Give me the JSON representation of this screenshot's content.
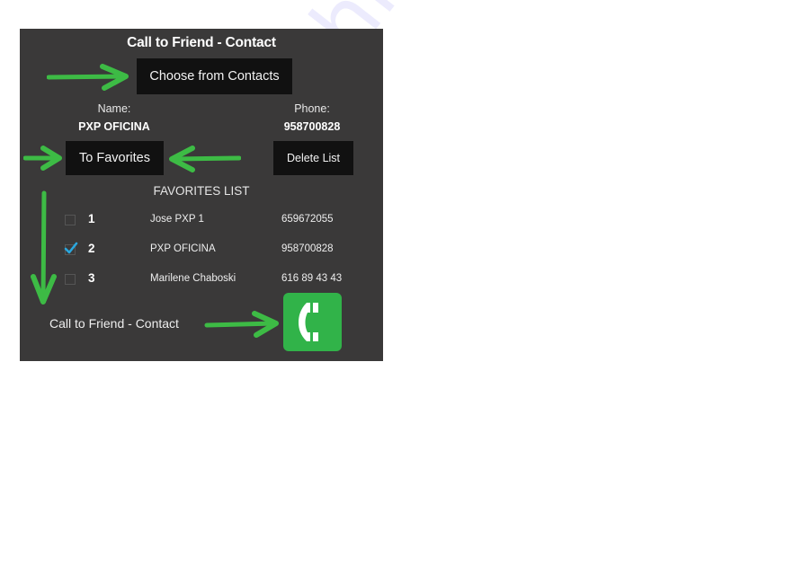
{
  "app": {
    "title": "Call to Friend - Contact"
  },
  "buttons": {
    "choose_contacts": "Choose from Contacts",
    "to_favorites": "To Favorites",
    "delete_list": "Delete List"
  },
  "selected_contact": {
    "name_label": "Name:",
    "name_value": "PXP OFICINA",
    "phone_label": "Phone:",
    "phone_value": "958700828"
  },
  "favorites": {
    "heading": "FAVORITES LIST",
    "rows": [
      {
        "index": "1",
        "name": "Jose PXP 1",
        "phone": "659672055",
        "checked": false
      },
      {
        "index": "2",
        "name": "PXP OFICINA",
        "phone": "958700828",
        "checked": true
      },
      {
        "index": "3",
        "name": "Marilene Chaboski",
        "phone": "616 89 43 43",
        "checked": false
      }
    ]
  },
  "footer": {
    "label": "Call to Friend - Contact",
    "call_icon": "phone-handset-icon"
  },
  "colors": {
    "panel_bg": "#3a3939",
    "button_bg": "#111111",
    "accent_green": "#31b349",
    "arrow_green": "#3dbb45",
    "checkbox_blue": "#2aa7de"
  },
  "watermark": "shive.com"
}
